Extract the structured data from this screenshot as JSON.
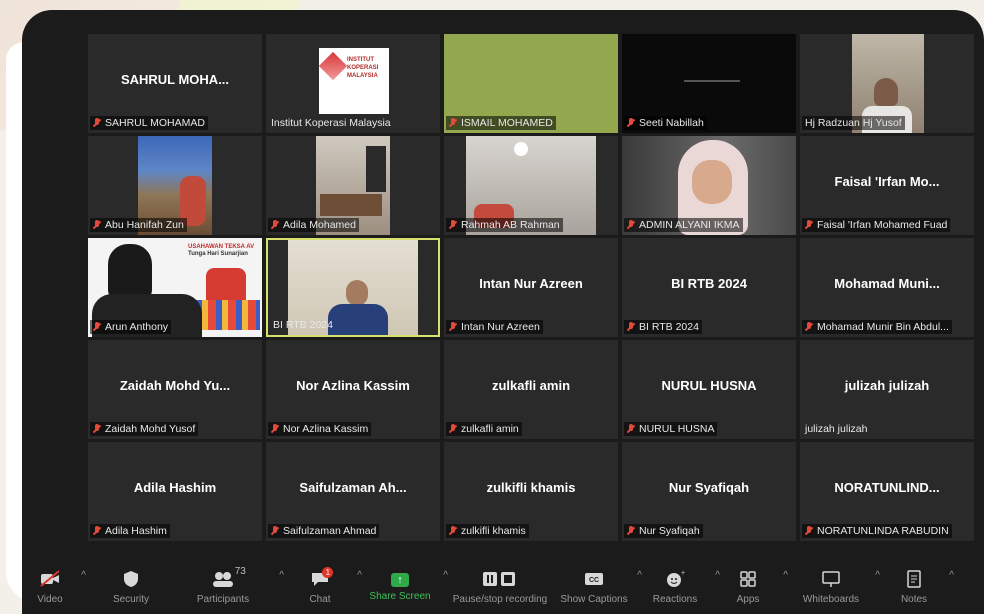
{
  "tiles": [
    {
      "center": "SAHRUL MOHA...",
      "label": "SAHRUL MOHAMAD",
      "muted": true
    },
    {
      "center": "",
      "label": "Institut Koperasi Malaysia",
      "muted": false
    },
    {
      "center": "",
      "label": "ISMAIL MOHAMED",
      "muted": true
    },
    {
      "center": "",
      "label": "Seeti Nabillah",
      "muted": true
    },
    {
      "center": "",
      "label": "Hj Radzuan Hj Yusof",
      "muted": false
    },
    {
      "center": "",
      "label": "Abu Hanifah Zun",
      "muted": true
    },
    {
      "center": "",
      "label": "Adila Mohamed",
      "muted": true
    },
    {
      "center": "",
      "label": "Rahmah AB Rahman",
      "muted": true
    },
    {
      "center": "",
      "label": "ADMIN ALYANI IKMA",
      "muted": true
    },
    {
      "center": "Faisal 'Irfan Mo...",
      "label": "Faisal 'Irfan Mohamed Fuad",
      "muted": true
    },
    {
      "center": "",
      "label": "Arun Anthony",
      "muted": true
    },
    {
      "center": "",
      "label": "BI RTB 2024",
      "muted": false
    },
    {
      "center": "Intan Nur Azreen",
      "label": "Intan Nur Azreen",
      "muted": true
    },
    {
      "center": "BI RTB 2024",
      "label": "BI RTB 2024",
      "muted": true
    },
    {
      "center": "Mohamad Muni...",
      "label": "Mohamad Munir Bin Abdul...",
      "muted": true
    },
    {
      "center": "Zaidah Mohd Yu...",
      "label": "Zaidah Mohd Yusof",
      "muted": true
    },
    {
      "center": "Nor Azlina Kassim",
      "label": "Nor Azlina Kassim",
      "muted": true
    },
    {
      "center": "zulkafli amin",
      "label": "zulkafli amin",
      "muted": true
    },
    {
      "center": "NURUL HUSNA",
      "label": "NURUL HUSNA",
      "muted": true
    },
    {
      "center": "julizah julizah",
      "label": "julizah julizah",
      "muted": false
    },
    {
      "center": "Adila Hashim",
      "label": "Adila Hashim",
      "muted": true
    },
    {
      "center": "Saifulzaman Ah...",
      "label": "Saifulzaman Ahmad",
      "muted": true
    },
    {
      "center": "zulkifli khamis",
      "label": "zulkifli khamis",
      "muted": true
    },
    {
      "center": "Nur Syafiqah",
      "label": "Nur Syafiqah",
      "muted": true
    },
    {
      "center": "NORATUNLIND...",
      "label": "NORATUNLINDA RABUDIN",
      "muted": true
    }
  ],
  "logo_text": [
    "INSTITUT",
    "KOPERASI",
    "MALAYSIA"
  ],
  "banner_text": [
    "USAHAWAN TEKSA AV",
    "Tunga Hari Sunarjian"
  ],
  "toolbar": {
    "video": "Video",
    "security": "Security",
    "participants": "Participants",
    "participants_count": "73",
    "chat": "Chat",
    "chat_badge": "1",
    "share": "Share Screen",
    "recording": "Pause/stop recording",
    "captions": "Show Captions",
    "reactions": "Reactions",
    "apps": "Apps",
    "whiteboards": "Whiteboards",
    "notes": "Notes"
  },
  "colors": {
    "active_border": "#d6e06a",
    "share_green": "#2fa84a",
    "muted_red": "#e24a3b"
  }
}
